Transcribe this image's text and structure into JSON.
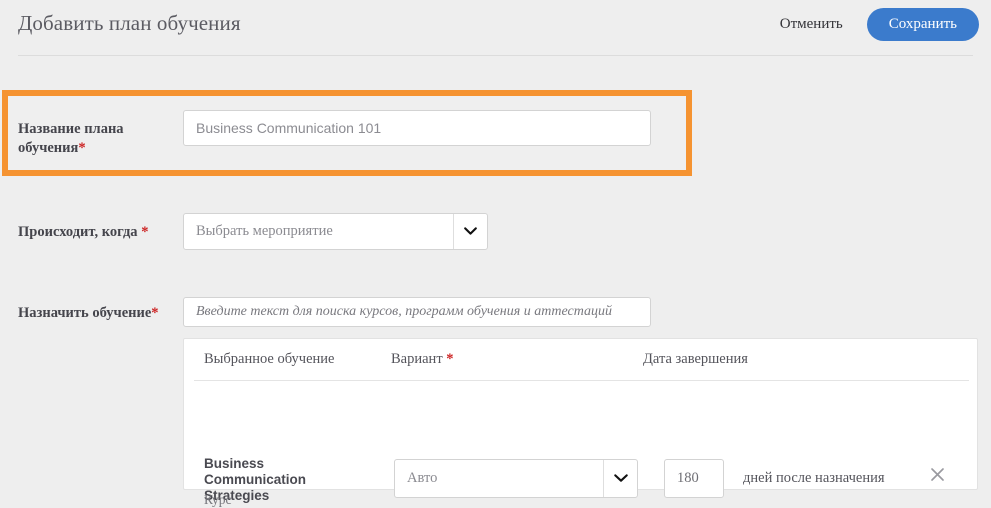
{
  "header": {
    "title": "Добавить план обучения",
    "cancel_label": "Отменить",
    "save_label": "Сохранить"
  },
  "form": {
    "plan_name": {
      "label": "Название плана обучения",
      "required_marker": "*",
      "value": "Business Communication 101",
      "placeholder": "Business Communication 101",
      "highlighted": true,
      "highlight_color": "#f59331"
    },
    "occurs_when": {
      "label": "Происходит, когда",
      "required_marker": "*",
      "selected": "Выбрать мероприятие",
      "icon": "chevron-down-icon"
    },
    "assign_training": {
      "label": "Назначить обучение",
      "required_marker": "*",
      "value": "",
      "placeholder": "Введите текст для поиска курсов, программ обучения и аттестаций"
    }
  },
  "training_table": {
    "columns": [
      {
        "key": "selected",
        "label": "Выбранное обучение",
        "required_marker": ""
      },
      {
        "key": "variant",
        "label": "Вариант",
        "required_marker": "*"
      },
      {
        "key": "due_date",
        "label": "Дата завершения",
        "required_marker": ""
      }
    ],
    "rows": [
      {
        "title": "Business Communication Strategies",
        "type": "Курс",
        "variant": "Авто",
        "variant_icon": "chevron-down-icon",
        "days": "180",
        "days_suffix": "дней после назначения",
        "remove_icon": "close-icon"
      }
    ]
  },
  "colors": {
    "accent_blue": "#3b7bcc",
    "highlight_orange": "#f59331",
    "required_red": "#cc2222",
    "page_bg": "#eeeeee"
  }
}
